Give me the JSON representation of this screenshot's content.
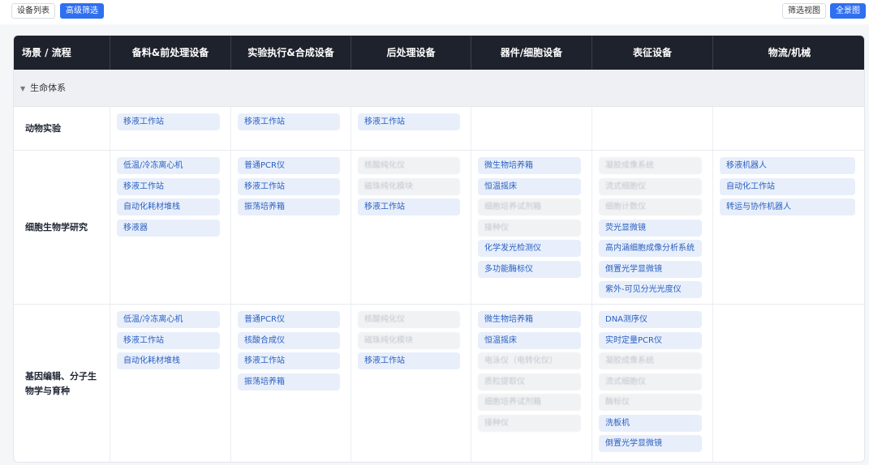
{
  "toolbar": {
    "device_list": "设备列表",
    "advanced_filter": "高级筛选",
    "filter_view": "筛选视图",
    "full_view": "全景图"
  },
  "columns": [
    "场景 / 流程",
    "备料&前处理设备",
    "实验执行&合成设备",
    "后处理设备",
    "器件/细胞设备",
    "表征设备",
    "物流/机械"
  ],
  "group": {
    "label": "生命体系"
  },
  "rows": [
    {
      "label": "动物实验",
      "cells": [
        [
          {
            "text": "移液工作站",
            "active": true
          }
        ],
        [
          {
            "text": "移液工作站",
            "active": true
          }
        ],
        [
          {
            "text": "移液工作站",
            "active": true
          }
        ],
        [],
        [],
        []
      ]
    },
    {
      "label": "细胞生物学研究",
      "cells": [
        [
          {
            "text": "低温/冷冻离心机",
            "active": true
          },
          {
            "text": "移液工作站",
            "active": true
          },
          {
            "text": "自动化耗材堆栈",
            "active": true
          },
          {
            "text": "移液器",
            "active": true
          }
        ],
        [
          {
            "text": "普通PCR仪",
            "active": true
          },
          {
            "text": "移液工作站",
            "active": true
          },
          {
            "text": "振荡培养箱",
            "active": true
          }
        ],
        [
          {
            "text": "核酸纯化仪",
            "active": false
          },
          {
            "text": "磁珠纯化模块",
            "active": false
          },
          {
            "text": "移液工作站",
            "active": true
          }
        ],
        [
          {
            "text": "微生物培养箱",
            "active": true
          },
          {
            "text": "恒温摇床",
            "active": true
          },
          {
            "text": "细胞培养试剂箱",
            "active": false
          },
          {
            "text": "接种仪",
            "active": false
          },
          {
            "text": "化学发光检测仪",
            "active": true
          },
          {
            "text": "多功能酶标仪",
            "active": true
          }
        ],
        [
          {
            "text": "凝胶成像系统",
            "active": false
          },
          {
            "text": "流式细胞仪",
            "active": false
          },
          {
            "text": "细胞计数仪",
            "active": false
          },
          {
            "text": "荧光显微镜",
            "active": true
          },
          {
            "text": "高内涵细胞成像分析系统",
            "active": true
          },
          {
            "text": "倒置光学显微镜",
            "active": true
          },
          {
            "text": "紫外-可见分光光度仪",
            "active": true
          }
        ],
        [
          {
            "text": "移液机器人",
            "active": true
          },
          {
            "text": "自动化工作站",
            "active": true
          },
          {
            "text": "转运与协作机器人",
            "active": true
          }
        ]
      ]
    },
    {
      "label": "基因编辑、分子生物学与育种",
      "cells": [
        [
          {
            "text": "低温/冷冻离心机",
            "active": true
          },
          {
            "text": "移液工作站",
            "active": true
          },
          {
            "text": "自动化耗材堆栈",
            "active": true
          }
        ],
        [
          {
            "text": "普通PCR仪",
            "active": true
          },
          {
            "text": "核酸合成仪",
            "active": true
          },
          {
            "text": "移液工作站",
            "active": true
          },
          {
            "text": "振荡培养箱",
            "active": true
          }
        ],
        [
          {
            "text": "核酸纯化仪",
            "active": false
          },
          {
            "text": "磁珠纯化模块",
            "active": false
          },
          {
            "text": "移液工作站",
            "active": true
          }
        ],
        [
          {
            "text": "微生物培养箱",
            "active": true
          },
          {
            "text": "恒温摇床",
            "active": true
          },
          {
            "text": "电泳仪（电转化仪）",
            "active": false
          },
          {
            "text": "质粒提取仪",
            "active": false
          },
          {
            "text": "细胞培养试剂箱",
            "active": false
          },
          {
            "text": "接种仪",
            "active": false
          }
        ],
        [
          {
            "text": "DNA测序仪",
            "active": true
          },
          {
            "text": "实时定量PCR仪",
            "active": true
          },
          {
            "text": "凝胶成像系统",
            "active": false
          },
          {
            "text": "流式细胞仪",
            "active": false
          },
          {
            "text": "酶标仪",
            "active": false
          },
          {
            "text": "洗板机",
            "active": true
          },
          {
            "text": "倒置光学显微镜",
            "active": true
          }
        ],
        []
      ]
    }
  ]
}
